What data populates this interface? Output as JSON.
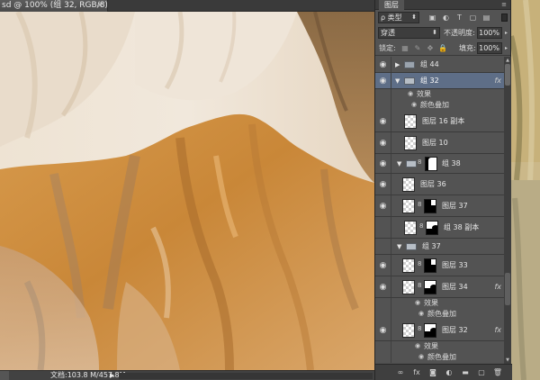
{
  "document": {
    "tab_title": "sd @ 100% (组 32, RGB/8) *",
    "close_glyph": "×",
    "status_text": "文档:103.8 M/457.8M",
    "status_arrow": "▶"
  },
  "panel": {
    "tab_label": "图层",
    "menu_glyph": "≡",
    "filter": {
      "kind_label": "ρ 类型",
      "chevron": "⬍",
      "icons": [
        "pixel-filter-icon",
        "adjustment-filter-icon",
        "type-filter-icon",
        "shape-filter-icon",
        "smart-object-filter-icon"
      ],
      "icon_glyphs": [
        "▣",
        "◐",
        "T",
        "▢",
        "▤"
      ]
    },
    "blend_mode": "穿透",
    "blend_chevron": "⬍",
    "opacity_label": "不透明度:",
    "opacity_value": "100%",
    "lock_label": "锁定:",
    "lock_glyphs": [
      "▦",
      "✎",
      "✥",
      "🔒"
    ],
    "fill_label": "填充:",
    "fill_value": "100%",
    "arrow_glyph": "▸",
    "footer_icons": [
      "∞",
      "fx",
      "◙",
      "◐",
      "▬",
      "▢",
      "🗑"
    ]
  },
  "layers": [
    {
      "type": "group",
      "name": "组 44",
      "expanded": false,
      "visible": true,
      "selected": false
    },
    {
      "type": "group",
      "name": "组 32",
      "expanded": true,
      "visible": true,
      "selected": true,
      "fx": "fx"
    },
    {
      "type": "effects-header",
      "name": "效果"
    },
    {
      "type": "effect",
      "name": "颜色叠加"
    },
    {
      "type": "layer",
      "name": "图层 16 副本",
      "visible": true,
      "mask": false
    },
    {
      "type": "layer",
      "name": "图层 10",
      "visible": true,
      "mask": false
    },
    {
      "type": "group",
      "name": "组 38",
      "expanded": true,
      "visible": true,
      "selected": false,
      "mask": true
    },
    {
      "type": "layer",
      "name": "图层 36",
      "visible": true,
      "mask": false
    },
    {
      "type": "layer",
      "name": "图层 37",
      "visible": true,
      "mask": true
    },
    {
      "type": "layer",
      "name": "组 38 副本",
      "visible": false,
      "mask": true
    },
    {
      "type": "group",
      "name": "组 37",
      "expanded": true,
      "visible": false,
      "selected": false
    },
    {
      "type": "layer",
      "name": "图层 33",
      "visible": true,
      "mask": true
    },
    {
      "type": "layer",
      "name": "图层 34",
      "visible": true,
      "mask": true,
      "fx": "fx"
    },
    {
      "type": "effects-header",
      "name": "效果"
    },
    {
      "type": "effect",
      "name": "颜色叠加"
    },
    {
      "type": "layer",
      "name": "图层 32",
      "visible": true,
      "mask": true,
      "fx": "fx"
    },
    {
      "type": "effects-header",
      "name": "效果"
    },
    {
      "type": "effect",
      "name": "颜色叠加"
    }
  ],
  "glyphs": {
    "eye": "◉",
    "collapsed": "▶",
    "expanded": "▼",
    "chain": "8",
    "effect_eye": "◉"
  },
  "colors": {
    "selection": "#5e6e87",
    "panel_bg": "#535353",
    "canvas_ochre": "#c9893f",
    "canvas_cream": "#efe3d2"
  }
}
